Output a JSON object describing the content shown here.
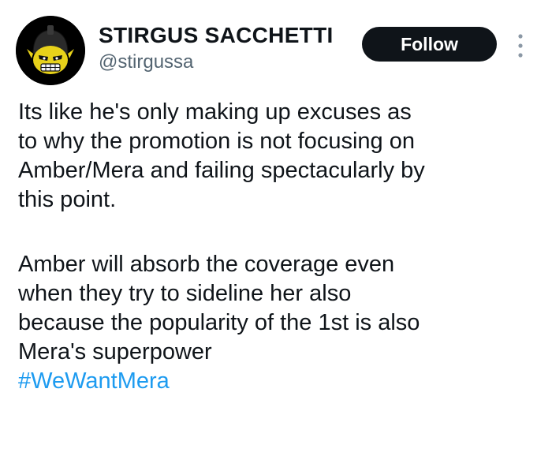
{
  "author": {
    "display_name": "STIRGUS SACCHETTI",
    "handle": "@stirgussa",
    "avatar_icon": "skull-helmet-avatar"
  },
  "actions": {
    "follow_label": "Follow",
    "more_icon": "more-dots-vertical-icon"
  },
  "tweet": {
    "paragraph_1_lines": [
      "Its like he's only making up excuses as",
      "to why the promotion is not focusing on",
      "Amber/Mera and failing spectacularly by",
      "this point."
    ],
    "paragraph_2_lines": [
      "Amber will absorb the coverage even",
      "when they try to sideline her also",
      "because the popularity of the 1st is also",
      "Mera's superpower"
    ],
    "hashtag": "#WeWantMera"
  },
  "colors": {
    "text": "#0f1419",
    "secondary": "#536471",
    "link": "#1d9bf0",
    "button_bg": "#0f1419"
  }
}
